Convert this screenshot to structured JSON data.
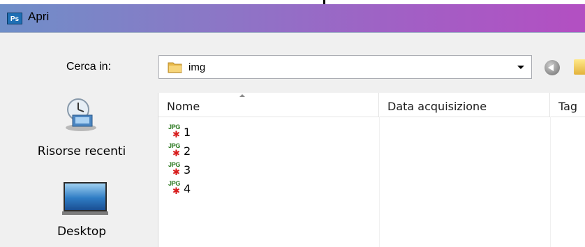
{
  "window": {
    "app_icon_text": "Ps",
    "title": "Apri"
  },
  "toolbar": {
    "look_in_label": "Cerca in:",
    "current_folder": "img",
    "back_icon": "back-arrow-icon",
    "up_icon": "folder-up-icon"
  },
  "places": [
    {
      "label": "Risorse recenti",
      "icon": "recent-places-icon"
    },
    {
      "label": "Desktop",
      "icon": "desktop-icon"
    }
  ],
  "file_list": {
    "columns": [
      {
        "label": "Nome",
        "sorted": "ascending"
      },
      {
        "label": "Data acquisizione"
      },
      {
        "label": "Tag"
      }
    ],
    "files": [
      {
        "icon_text": "JPG",
        "name": "1"
      },
      {
        "icon_text": "JPG",
        "name": "2"
      },
      {
        "icon_text": "JPG",
        "name": "3"
      },
      {
        "icon_text": "JPG",
        "name": "4"
      }
    ]
  }
}
